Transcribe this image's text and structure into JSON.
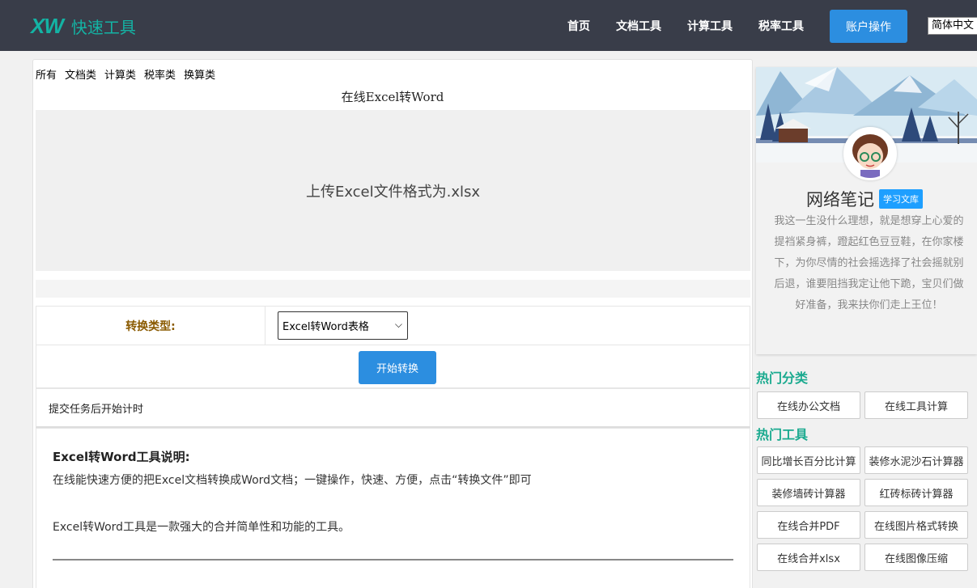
{
  "header": {
    "logo_mark": "XW",
    "logo_text": "快速工具",
    "nav": [
      "首页",
      "文档工具",
      "计算工具",
      "税率工具"
    ],
    "account_button": "账户操作",
    "language": "简体中文",
    "bg_color": "#393d49",
    "accent_color": "#14b3a4"
  },
  "main": {
    "categories": [
      "所有",
      "文档类",
      "计算类",
      "税率类",
      "换算类"
    ],
    "title": "在线Excel转Word",
    "upload_text": "上传Excel文件格式为.xlsx",
    "form": {
      "type_label": "转换类型:",
      "type_selected": "Excel转Word表格",
      "start_button": "开始转换"
    },
    "timer_text": "提交任务后开始计时",
    "description": {
      "heading": "Excel转Word工具说明:",
      "line1": "在线能快速方便的把Excel文档转换成Word文档；一键操作，快速、方便，点击“转换文件”即可",
      "line2": "Excel转Word工具是一款强大的合并简单性和功能的工具。"
    },
    "button_color": "#2c8ee0"
  },
  "sidebar": {
    "profile": {
      "name": "网络笔记",
      "tag": "学习文库",
      "bio": "我这一生没什么理想，就是想穿上心爱的提裆紧身裤，蹬起红色豆豆鞋，在你家楼下，为你尽情的社会摇选择了社会摇就别后退，谁要阻挡我定让他下跪，宝贝们做好准备，我来扶你们走上王位！"
    },
    "hot_categories_title": "热门分类",
    "hot_categories": [
      "在线办公文档",
      "在线工具计算"
    ],
    "hot_tools_title": "热门工具",
    "hot_tools": [
      "同比增长百分比计算",
      "装修水泥沙石计算器",
      "装修墙砖计算器",
      "红砖标砖计算器",
      "在线合并PDF",
      "在线图片格式转换",
      "在线合并xlsx",
      "在线图像压缩"
    ],
    "section_color": "#1aaa8f"
  }
}
